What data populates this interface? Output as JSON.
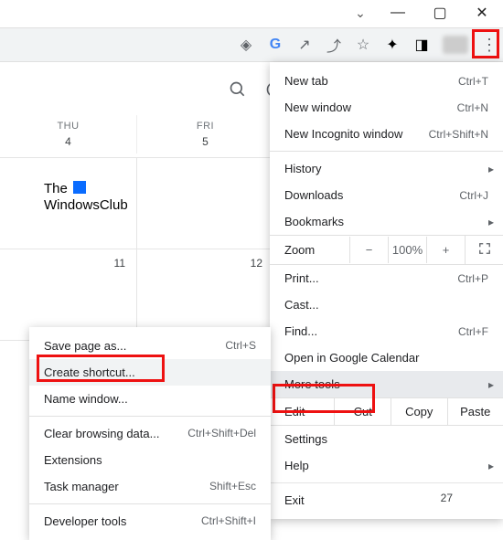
{
  "window_controls": {
    "chevron": "⌄",
    "minimize": "—",
    "maximize": "▢",
    "close": "✕"
  },
  "toolbar_icons": {
    "eye": "◈",
    "google": "G",
    "open": "↗",
    "share": "⤴",
    "star": "☆",
    "puzzle": "✦",
    "panel": "◨",
    "kebab": "⋮"
  },
  "cal_icons": {
    "search": "🔍",
    "help": "?"
  },
  "calendar": {
    "headers": [
      {
        "dow": "THU",
        "num": "4"
      },
      {
        "dow": "FRI",
        "num": "5"
      }
    ],
    "row2": [
      "11",
      "12"
    ],
    "row3_right": "27"
  },
  "logo": {
    "line1": "The",
    "line2": "WindowsClub"
  },
  "menu": {
    "new_tab": "New tab",
    "new_tab_sc": "Ctrl+T",
    "new_window": "New window",
    "new_window_sc": "Ctrl+N",
    "new_incog": "New Incognito window",
    "new_incog_sc": "Ctrl+Shift+N",
    "history": "History",
    "downloads": "Downloads",
    "downloads_sc": "Ctrl+J",
    "bookmarks": "Bookmarks",
    "zoom_label": "Zoom",
    "zoom_minus": "−",
    "zoom_val": "100%",
    "zoom_plus": "+",
    "print": "Print...",
    "print_sc": "Ctrl+P",
    "cast": "Cast...",
    "find": "Find...",
    "find_sc": "Ctrl+F",
    "open_in": "Open in Google Calendar",
    "more_tools": "More tools",
    "edit": "Edit",
    "cut": "Cut",
    "copy": "Copy",
    "paste": "Paste",
    "settings": "Settings",
    "help": "Help",
    "exit": "Exit"
  },
  "submenu": {
    "save_page": "Save page as...",
    "save_page_sc": "Ctrl+S",
    "create_shortcut": "Create shortcut...",
    "name_window": "Name window...",
    "clear_data": "Clear browsing data...",
    "clear_data_sc": "Ctrl+Shift+Del",
    "extensions": "Extensions",
    "task_mgr": "Task manager",
    "task_mgr_sc": "Shift+Esc",
    "dev_tools": "Developer tools",
    "dev_tools_sc": "Ctrl+Shift+I"
  }
}
